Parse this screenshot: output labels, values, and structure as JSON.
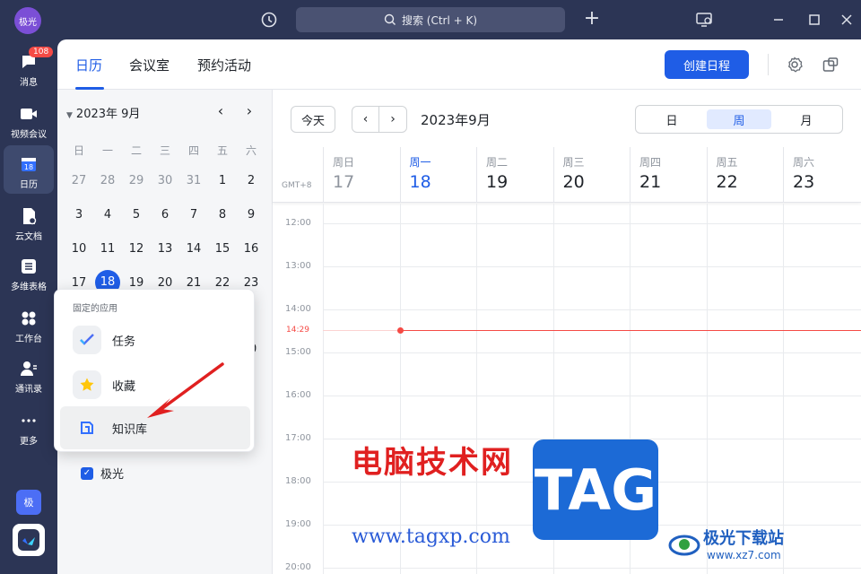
{
  "titlebar": {
    "avatar_text": "极光",
    "search_placeholder": "搜索 (Ctrl + K)"
  },
  "sidebar": {
    "items": [
      {
        "label": "消息",
        "badge": "108"
      },
      {
        "label": "视频会议"
      },
      {
        "label": "日历"
      },
      {
        "label": "云文档"
      },
      {
        "label": "多维表格"
      },
      {
        "label": "工作台"
      },
      {
        "label": "通讯录"
      },
      {
        "label": "更多"
      }
    ],
    "brand_label": "极"
  },
  "header": {
    "tabs": [
      "日历",
      "会议室",
      "预约活动"
    ],
    "create_label": "创建日程"
  },
  "mini_calendar": {
    "title": "2023年 9月",
    "weekdays": [
      "日",
      "一",
      "二",
      "三",
      "四",
      "五",
      "六"
    ],
    "weeks": [
      [
        "27",
        "28",
        "29",
        "30",
        "31",
        "1",
        "2"
      ],
      [
        "3",
        "4",
        "5",
        "6",
        "7",
        "8",
        "9"
      ],
      [
        "10",
        "11",
        "12",
        "13",
        "14",
        "15",
        "16"
      ],
      [
        "17",
        "18",
        "19",
        "20",
        "21",
        "22",
        "23"
      ]
    ],
    "row4_partial": "0"
  },
  "my_calendar": {
    "label": "极光"
  },
  "popup": {
    "title": "固定的应用",
    "apps": [
      "任务",
      "收藏",
      "知识库"
    ]
  },
  "toolbar": {
    "today_label": "今天",
    "prev": "‹",
    "next": "›",
    "period_title": "2023年9月",
    "views": [
      "日",
      "周",
      "月"
    ]
  },
  "week": {
    "timezone": "GMT+8",
    "days": [
      {
        "wd": "周日",
        "dn": "17"
      },
      {
        "wd": "周一",
        "dn": "18"
      },
      {
        "wd": "周二",
        "dn": "19"
      },
      {
        "wd": "周三",
        "dn": "20"
      },
      {
        "wd": "周四",
        "dn": "21"
      },
      {
        "wd": "周五",
        "dn": "22"
      },
      {
        "wd": "周六",
        "dn": "23"
      }
    ],
    "hours": [
      "12:00",
      "13:00",
      "14:00",
      "15:00",
      "16:00",
      "17:00",
      "18:00",
      "19:00",
      "20:00"
    ],
    "now_time": "14:29"
  },
  "watermark": {
    "cn_text": "电脑技术网",
    "url": "www.tagxp.com",
    "tag": "TAG",
    "site_name": "极光下载站",
    "site_url": "www.xz7.com"
  },
  "colors": {
    "accent": "#1f5de6",
    "now": "#f54a45",
    "sidebar_bg": "#2c3555"
  }
}
